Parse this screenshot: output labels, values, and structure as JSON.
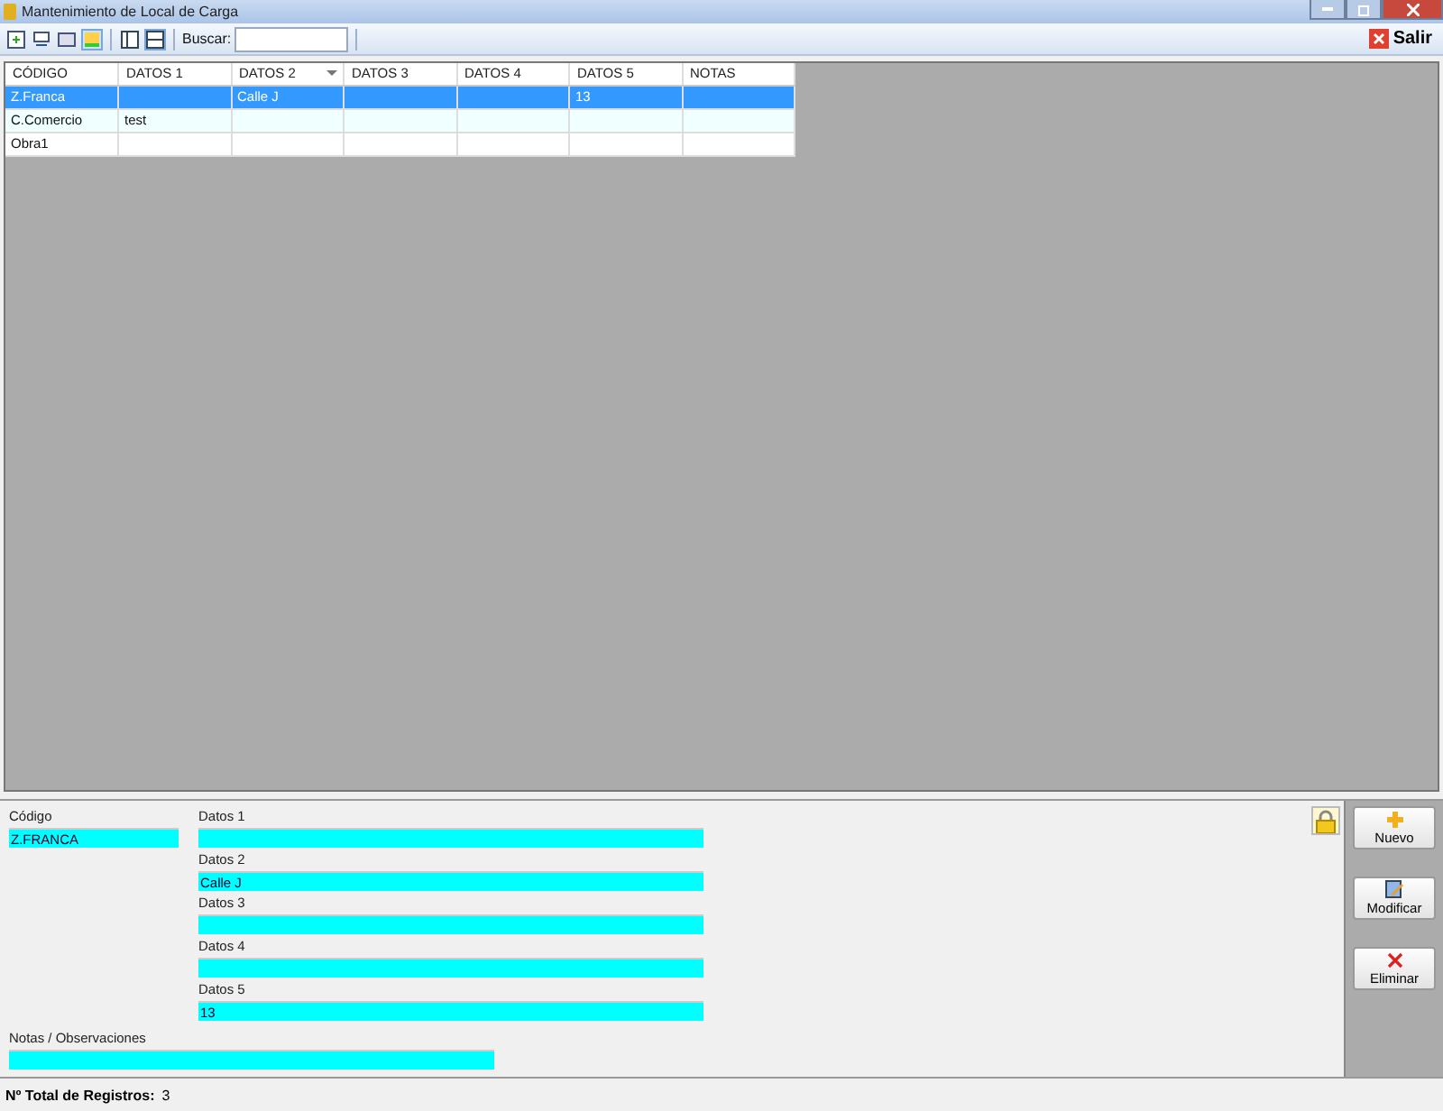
{
  "window": {
    "title": "Mantenimiento de Local de Carga"
  },
  "toolbar": {
    "search_label": "Buscar:",
    "exit_label": "Salir"
  },
  "table": {
    "columns": [
      {
        "label": "CÓDIGO",
        "sorted": false
      },
      {
        "label": "DATOS 1",
        "sorted": false
      },
      {
        "label": "DATOS 2",
        "sorted": true
      },
      {
        "label": "DATOS 3",
        "sorted": false
      },
      {
        "label": "DATOS 4",
        "sorted": false
      },
      {
        "label": "DATOS 5",
        "sorted": false
      },
      {
        "label": "NOTAS",
        "sorted": false
      }
    ],
    "rows": [
      {
        "selected": true,
        "cells": [
          "Z.Franca",
          null,
          "Calle J",
          null,
          null,
          "13",
          null
        ]
      },
      {
        "selected": false,
        "cells": [
          "C.Comercio",
          "test",
          null,
          null,
          null,
          null,
          null
        ]
      },
      {
        "selected": false,
        "cells": [
          "Obra1",
          null,
          null,
          null,
          null,
          null,
          null
        ]
      }
    ]
  },
  "form": {
    "code": {
      "label": "Código",
      "value": "Z.FRANCA"
    },
    "fields": [
      {
        "label": "Datos 1"
      },
      {
        "label": "Datos 2",
        "value": "Calle J"
      },
      {
        "label": "Datos 3"
      },
      {
        "label": "Datos 4"
      },
      {
        "label": "Datos 5",
        "value": "13"
      }
    ],
    "notes": {
      "label": "Notas / Observaciones"
    },
    "locked": true
  },
  "actions": [
    {
      "kind": "new",
      "label": "Nuevo"
    },
    {
      "kind": "edit",
      "label": "Modificar"
    },
    {
      "kind": "delete",
      "label": "Eliminar"
    }
  ],
  "status_bar": {
    "label": "Nº Total de Registros:",
    "value": "3"
  }
}
